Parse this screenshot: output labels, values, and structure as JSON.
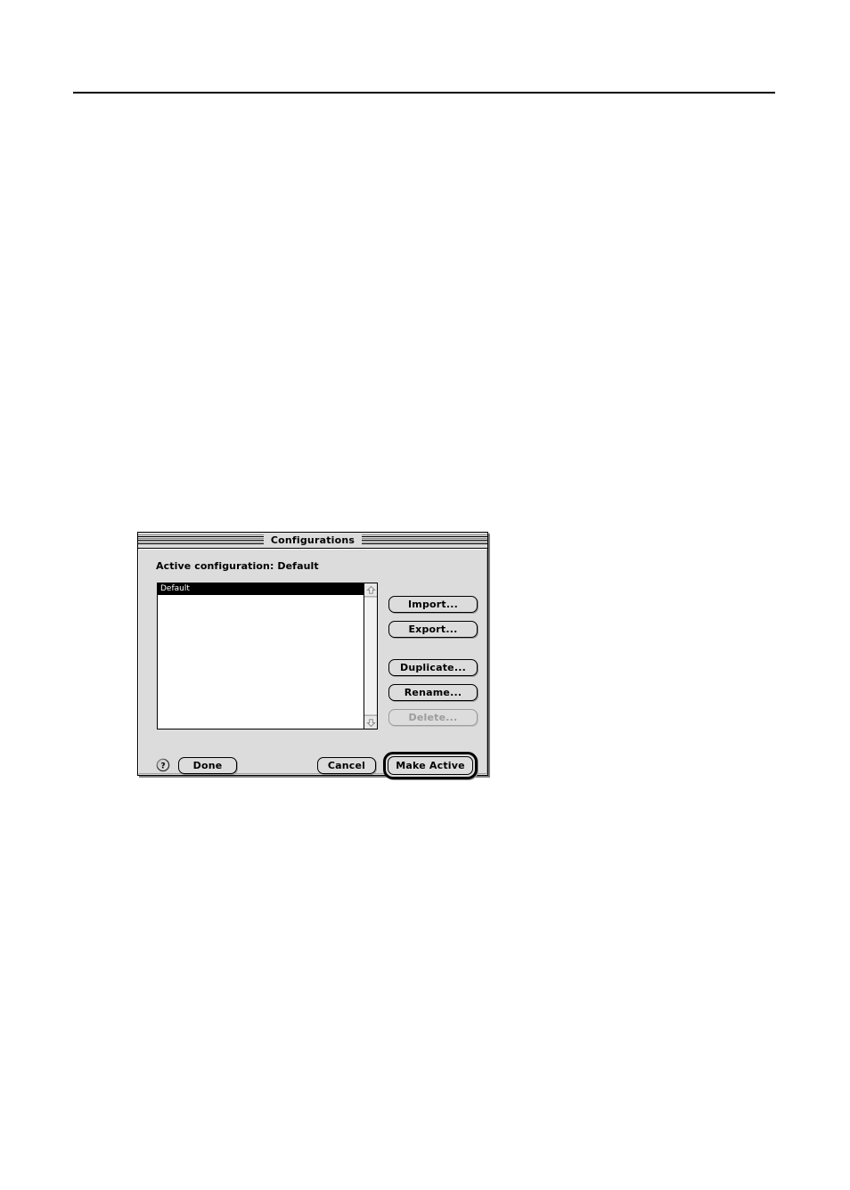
{
  "page": {
    "divider": "horizontal-rule"
  },
  "dialog": {
    "title": "Configurations",
    "active_config_label": "Active configuration: Default",
    "list": {
      "items": [
        {
          "label": "Default",
          "selected": true
        }
      ],
      "scrollbar": {
        "up_arrow": "scroll-up-arrow-icon",
        "down_arrow": "scroll-down-arrow-icon"
      }
    },
    "buttons": {
      "import": "Import...",
      "export": "Export...",
      "duplicate": "Duplicate...",
      "rename": "Rename...",
      "delete": "Delete...",
      "done": "Done",
      "cancel": "Cancel",
      "make_active": "Make Active"
    },
    "help_icon": "help-question-mark-icon",
    "colors": {
      "window_background": "#dcdcdc",
      "list_background": "#ffffff",
      "selection_background": "#000000",
      "selection_text": "#ffffff",
      "disabled_text": "#9c9c9c",
      "border": "#000000"
    }
  }
}
